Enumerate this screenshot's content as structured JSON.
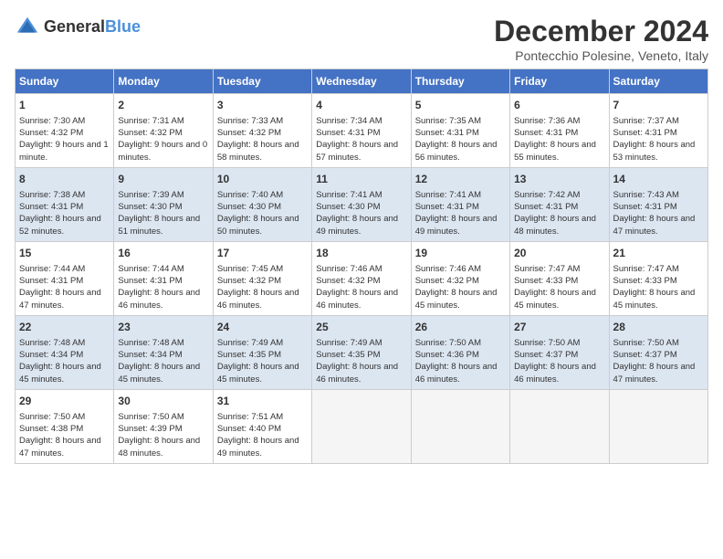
{
  "logo": {
    "line1": "General",
    "line2": "Blue"
  },
  "title": "December 2024",
  "location": "Pontecchio Polesine, Veneto, Italy",
  "days_of_week": [
    "Sunday",
    "Monday",
    "Tuesday",
    "Wednesday",
    "Thursday",
    "Friday",
    "Saturday"
  ],
  "weeks": [
    [
      {
        "day": "1",
        "sunrise": "7:30 AM",
        "sunset": "4:32 PM",
        "daylight": "9 hours and 1 minute."
      },
      {
        "day": "2",
        "sunrise": "7:31 AM",
        "sunset": "4:32 PM",
        "daylight": "9 hours and 0 minutes."
      },
      {
        "day": "3",
        "sunrise": "7:33 AM",
        "sunset": "4:32 PM",
        "daylight": "8 hours and 58 minutes."
      },
      {
        "day": "4",
        "sunrise": "7:34 AM",
        "sunset": "4:31 PM",
        "daylight": "8 hours and 57 minutes."
      },
      {
        "day": "5",
        "sunrise": "7:35 AM",
        "sunset": "4:31 PM",
        "daylight": "8 hours and 56 minutes."
      },
      {
        "day": "6",
        "sunrise": "7:36 AM",
        "sunset": "4:31 PM",
        "daylight": "8 hours and 55 minutes."
      },
      {
        "day": "7",
        "sunrise": "7:37 AM",
        "sunset": "4:31 PM",
        "daylight": "8 hours and 53 minutes."
      }
    ],
    [
      {
        "day": "8",
        "sunrise": "7:38 AM",
        "sunset": "4:31 PM",
        "daylight": "8 hours and 52 minutes."
      },
      {
        "day": "9",
        "sunrise": "7:39 AM",
        "sunset": "4:30 PM",
        "daylight": "8 hours and 51 minutes."
      },
      {
        "day": "10",
        "sunrise": "7:40 AM",
        "sunset": "4:30 PM",
        "daylight": "8 hours and 50 minutes."
      },
      {
        "day": "11",
        "sunrise": "7:41 AM",
        "sunset": "4:30 PM",
        "daylight": "8 hours and 49 minutes."
      },
      {
        "day": "12",
        "sunrise": "7:41 AM",
        "sunset": "4:31 PM",
        "daylight": "8 hours and 49 minutes."
      },
      {
        "day": "13",
        "sunrise": "7:42 AM",
        "sunset": "4:31 PM",
        "daylight": "8 hours and 48 minutes."
      },
      {
        "day": "14",
        "sunrise": "7:43 AM",
        "sunset": "4:31 PM",
        "daylight": "8 hours and 47 minutes."
      }
    ],
    [
      {
        "day": "15",
        "sunrise": "7:44 AM",
        "sunset": "4:31 PM",
        "daylight": "8 hours and 47 minutes."
      },
      {
        "day": "16",
        "sunrise": "7:44 AM",
        "sunset": "4:31 PM",
        "daylight": "8 hours and 46 minutes."
      },
      {
        "day": "17",
        "sunrise": "7:45 AM",
        "sunset": "4:32 PM",
        "daylight": "8 hours and 46 minutes."
      },
      {
        "day": "18",
        "sunrise": "7:46 AM",
        "sunset": "4:32 PM",
        "daylight": "8 hours and 46 minutes."
      },
      {
        "day": "19",
        "sunrise": "7:46 AM",
        "sunset": "4:32 PM",
        "daylight": "8 hours and 45 minutes."
      },
      {
        "day": "20",
        "sunrise": "7:47 AM",
        "sunset": "4:33 PM",
        "daylight": "8 hours and 45 minutes."
      },
      {
        "day": "21",
        "sunrise": "7:47 AM",
        "sunset": "4:33 PM",
        "daylight": "8 hours and 45 minutes."
      }
    ],
    [
      {
        "day": "22",
        "sunrise": "7:48 AM",
        "sunset": "4:34 PM",
        "daylight": "8 hours and 45 minutes."
      },
      {
        "day": "23",
        "sunrise": "7:48 AM",
        "sunset": "4:34 PM",
        "daylight": "8 hours and 45 minutes."
      },
      {
        "day": "24",
        "sunrise": "7:49 AM",
        "sunset": "4:35 PM",
        "daylight": "8 hours and 45 minutes."
      },
      {
        "day": "25",
        "sunrise": "7:49 AM",
        "sunset": "4:35 PM",
        "daylight": "8 hours and 46 minutes."
      },
      {
        "day": "26",
        "sunrise": "7:50 AM",
        "sunset": "4:36 PM",
        "daylight": "8 hours and 46 minutes."
      },
      {
        "day": "27",
        "sunrise": "7:50 AM",
        "sunset": "4:37 PM",
        "daylight": "8 hours and 46 minutes."
      },
      {
        "day": "28",
        "sunrise": "7:50 AM",
        "sunset": "4:37 PM",
        "daylight": "8 hours and 47 minutes."
      }
    ],
    [
      {
        "day": "29",
        "sunrise": "7:50 AM",
        "sunset": "4:38 PM",
        "daylight": "8 hours and 47 minutes."
      },
      {
        "day": "30",
        "sunrise": "7:50 AM",
        "sunset": "4:39 PM",
        "daylight": "8 hours and 48 minutes."
      },
      {
        "day": "31",
        "sunrise": "7:51 AM",
        "sunset": "4:40 PM",
        "daylight": "8 hours and 49 minutes."
      },
      null,
      null,
      null,
      null
    ]
  ],
  "labels": {
    "sunrise": "Sunrise:",
    "sunset": "Sunset:",
    "daylight": "Daylight:"
  }
}
